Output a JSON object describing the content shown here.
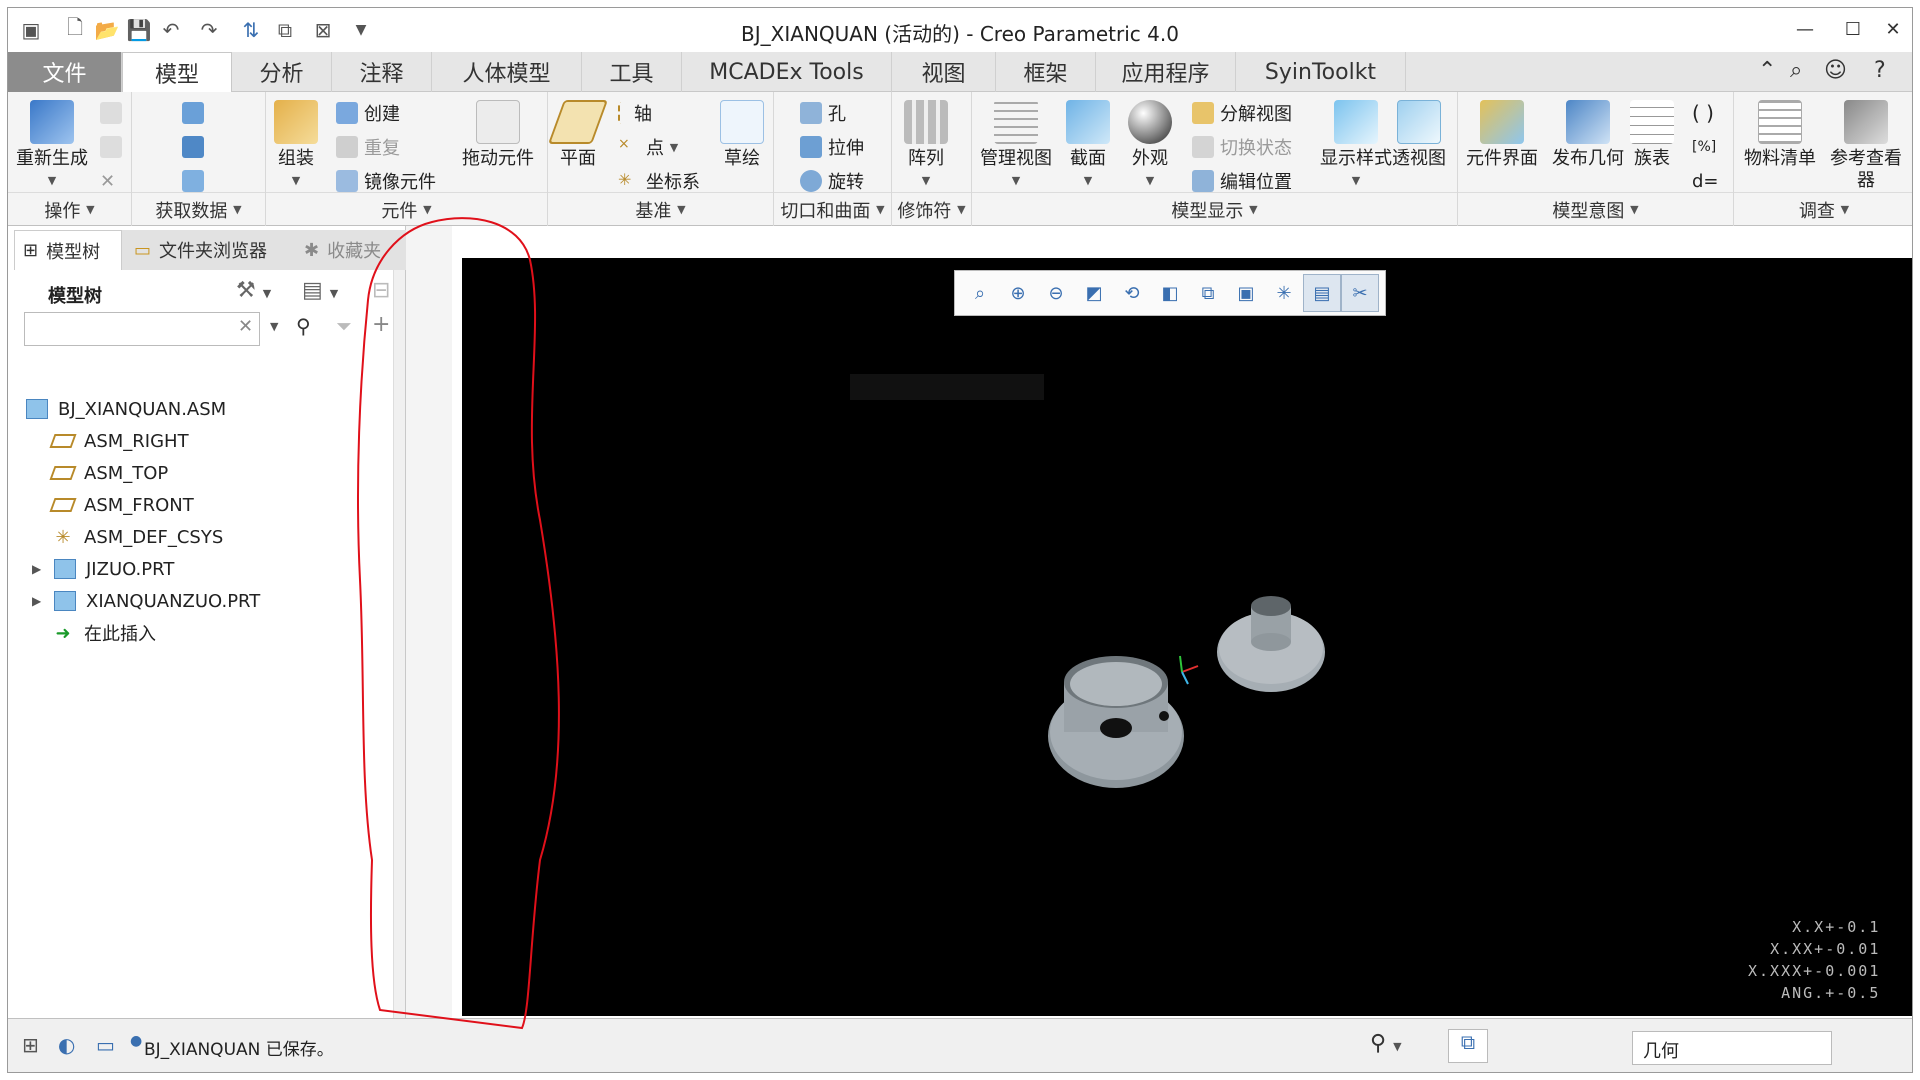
{
  "window": {
    "title": "BJ_XIANQUAN (活动的) - Creo Parametric 4.0"
  },
  "tabs": [
    "文件",
    "模型",
    "分析",
    "注释",
    "人体模型",
    "工具",
    "MCADEx Tools",
    "视图",
    "框架",
    "应用程序",
    "SyinToolkt"
  ],
  "ribbon": {
    "operations": {
      "label": "操作",
      "regen": "重新生成"
    },
    "getdata": {
      "label": "获取数据"
    },
    "component": {
      "label": "元件",
      "assemble": "组装",
      "create": "创建",
      "repeat": "重复",
      "mirror": "镜像元件",
      "drag": "拖动元件"
    },
    "datum": {
      "label": "基准",
      "plane": "平面",
      "axis": "轴",
      "point": "点",
      "csys": "坐标系",
      "sketch": "草绘"
    },
    "cut": {
      "label": "切口和曲面",
      "hole": "孔",
      "extrude": "拉伸",
      "revolve": "旋转"
    },
    "modifiers": {
      "label": "修饰符",
      "pattern": "阵列"
    },
    "display": {
      "label": "模型显示",
      "manage_view": "管理视图",
      "section": "截面",
      "appearance": "外观",
      "explode": "分解视图",
      "toggle_status": "切换状态",
      "edit_position": "编辑位置",
      "display_style": "显示样式",
      "perspective": "透视图"
    },
    "intent": {
      "label": "模型意图",
      "comp_interface": "元件界面",
      "publish_geom": "发布几何",
      "family_table": "族表"
    },
    "investigate": {
      "label": "调查",
      "bom": "物料清单",
      "ref_viewer": "参考查看器"
    }
  },
  "panel": {
    "tabs": [
      "模型树",
      "文件夹浏览器",
      "收藏夹"
    ],
    "header": "模型树",
    "tree": [
      {
        "label": "BJ_XIANQUAN.ASM",
        "type": "asm"
      },
      {
        "label": "ASM_RIGHT",
        "type": "plane"
      },
      {
        "label": "ASM_TOP",
        "type": "plane"
      },
      {
        "label": "ASM_FRONT",
        "type": "plane"
      },
      {
        "label": "ASM_DEF_CSYS",
        "type": "csys"
      },
      {
        "label": "JIZUO.PRT",
        "type": "part"
      },
      {
        "label": "XIANQUANZUO.PRT",
        "type": "part"
      },
      {
        "label": "在此插入",
        "type": "insert"
      }
    ]
  },
  "tolerances": [
    "X.X+-0.1",
    "X.XX+-0.01",
    "X.XXX+-0.001",
    "ANG.+-0.5"
  ],
  "status": {
    "message": "BJ_XIANQUAN 已保存。",
    "filter": "几何"
  },
  "colors": {
    "annotation": "#e0101a",
    "viewport": "#000000"
  }
}
